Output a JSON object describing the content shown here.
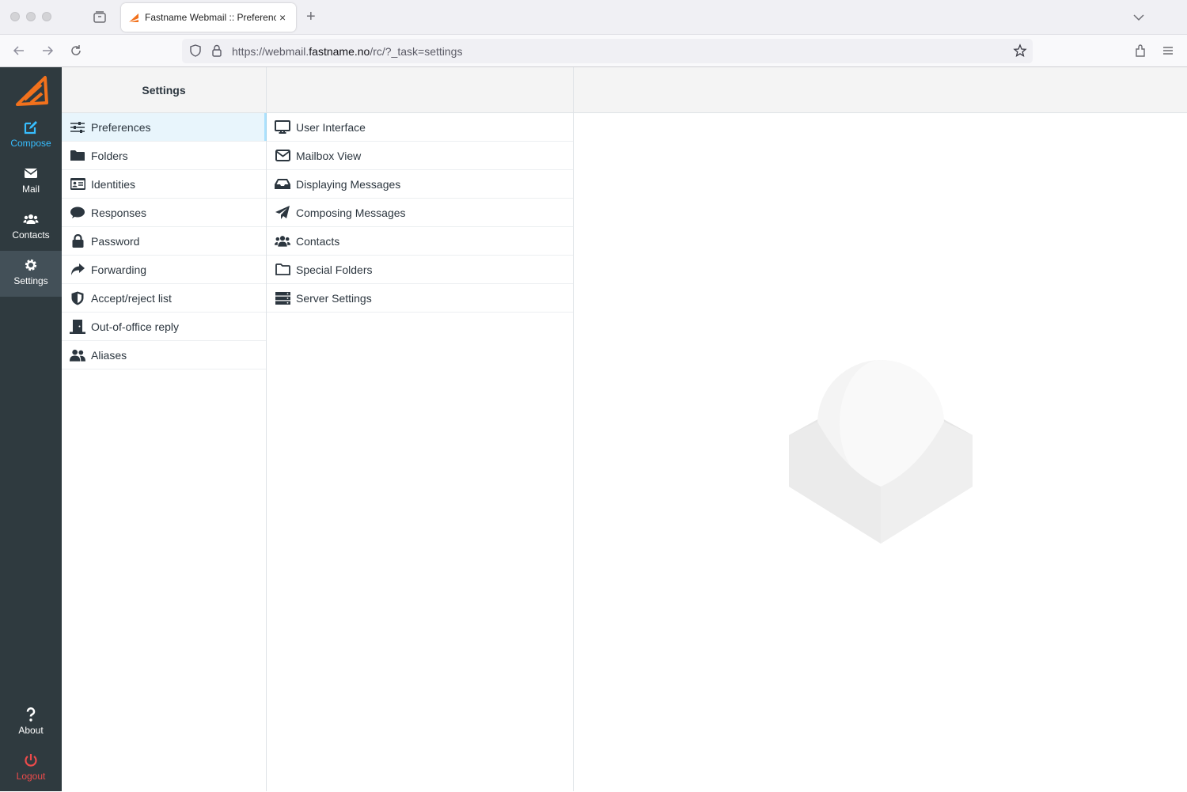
{
  "browser": {
    "tab_title": "Fastname Webmail :: Preferences",
    "new_tab_symbol": "+",
    "close_symbol": "×",
    "url_prefix": "https://webmail.",
    "url_domain": "fastname.no",
    "url_path": "/rc/?_task=settings"
  },
  "rail": {
    "items": [
      {
        "label": "Compose",
        "icon": "compose-icon"
      },
      {
        "label": "Mail",
        "icon": "envelope-icon"
      },
      {
        "label": "Contacts",
        "icon": "users-icon"
      },
      {
        "label": "Settings",
        "icon": "gear-icon"
      },
      {
        "label": "About",
        "icon": "question-icon"
      },
      {
        "label": "Logout",
        "icon": "power-icon"
      }
    ],
    "compose_color": "#37beff",
    "logout_color": "#ec4b4b"
  },
  "settings": {
    "header": "Settings",
    "items": [
      {
        "label": "Preferences",
        "icon": "sliders-icon"
      },
      {
        "label": "Folders",
        "icon": "folder-icon"
      },
      {
        "label": "Identities",
        "icon": "id-card-icon"
      },
      {
        "label": "Responses",
        "icon": "comment-icon"
      },
      {
        "label": "Password",
        "icon": "lock-icon"
      },
      {
        "label": "Forwarding",
        "icon": "share-icon"
      },
      {
        "label": "Accept/reject list",
        "icon": "shield-icon"
      },
      {
        "label": "Out-of-office reply",
        "icon": "door-icon"
      },
      {
        "label": "Aliases",
        "icon": "user-group-icon"
      }
    ]
  },
  "preferences": {
    "items": [
      {
        "label": "User Interface",
        "icon": "desktop-icon"
      },
      {
        "label": "Mailbox View",
        "icon": "envelope-outline-icon"
      },
      {
        "label": "Displaying Messages",
        "icon": "inbox-icon"
      },
      {
        "label": "Composing Messages",
        "icon": "paper-plane-icon"
      },
      {
        "label": "Contacts",
        "icon": "users-icon"
      },
      {
        "label": "Special Folders",
        "icon": "folder-outline-icon"
      },
      {
        "label": "Server Settings",
        "icon": "server-icon"
      }
    ]
  },
  "annotation_color": "#d0021b"
}
